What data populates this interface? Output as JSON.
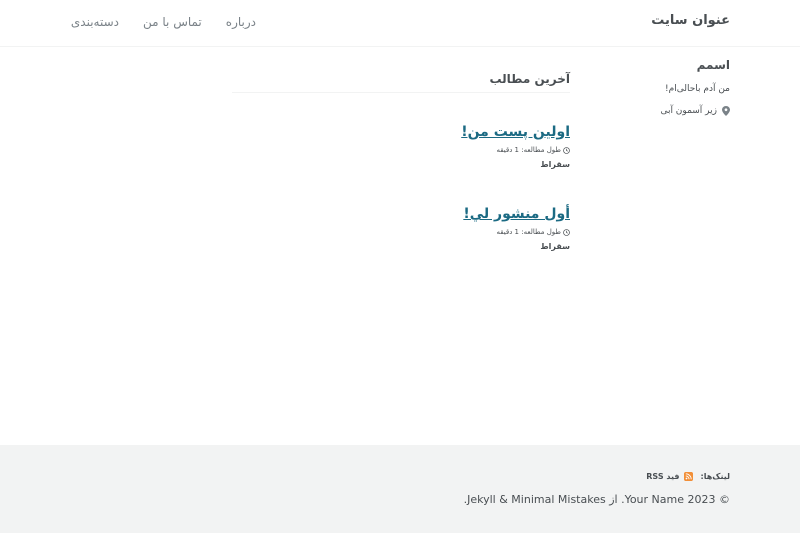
{
  "masthead": {
    "site_title": "عنوان سایت",
    "nav": [
      {
        "label": "درباره"
      },
      {
        "label": "تماس با من"
      },
      {
        "label": "دسته‌بندی"
      }
    ]
  },
  "sidebar": {
    "author_name": "اسمم",
    "bio": "من آدم باحالی‌ام!",
    "location": "زیر آسمون آبی",
    "location_icon": "map-marker-icon"
  },
  "main": {
    "section_title": "آخرین مطالب",
    "posts": [
      {
        "title": "اولین پست من!",
        "reading_time": "طول مطالعه: 1 دقیقه",
        "author": "سقراط"
      },
      {
        "title": "أول منشور لي!",
        "reading_time": "طول مطالعه: 1 دقیقه",
        "author": "سقراط"
      }
    ]
  },
  "footer": {
    "links_label": "لینک‌ها:",
    "rss_label": "فید RSS",
    "rss_icon": "rss-icon",
    "copyright": "© 2023 Your Name. از Jekyll & Minimal Mistakes."
  },
  "colors": {
    "link": "#1b6a83",
    "text": "#494e52",
    "footer_bg": "#f2f3f3",
    "rss": "#f28f38"
  }
}
